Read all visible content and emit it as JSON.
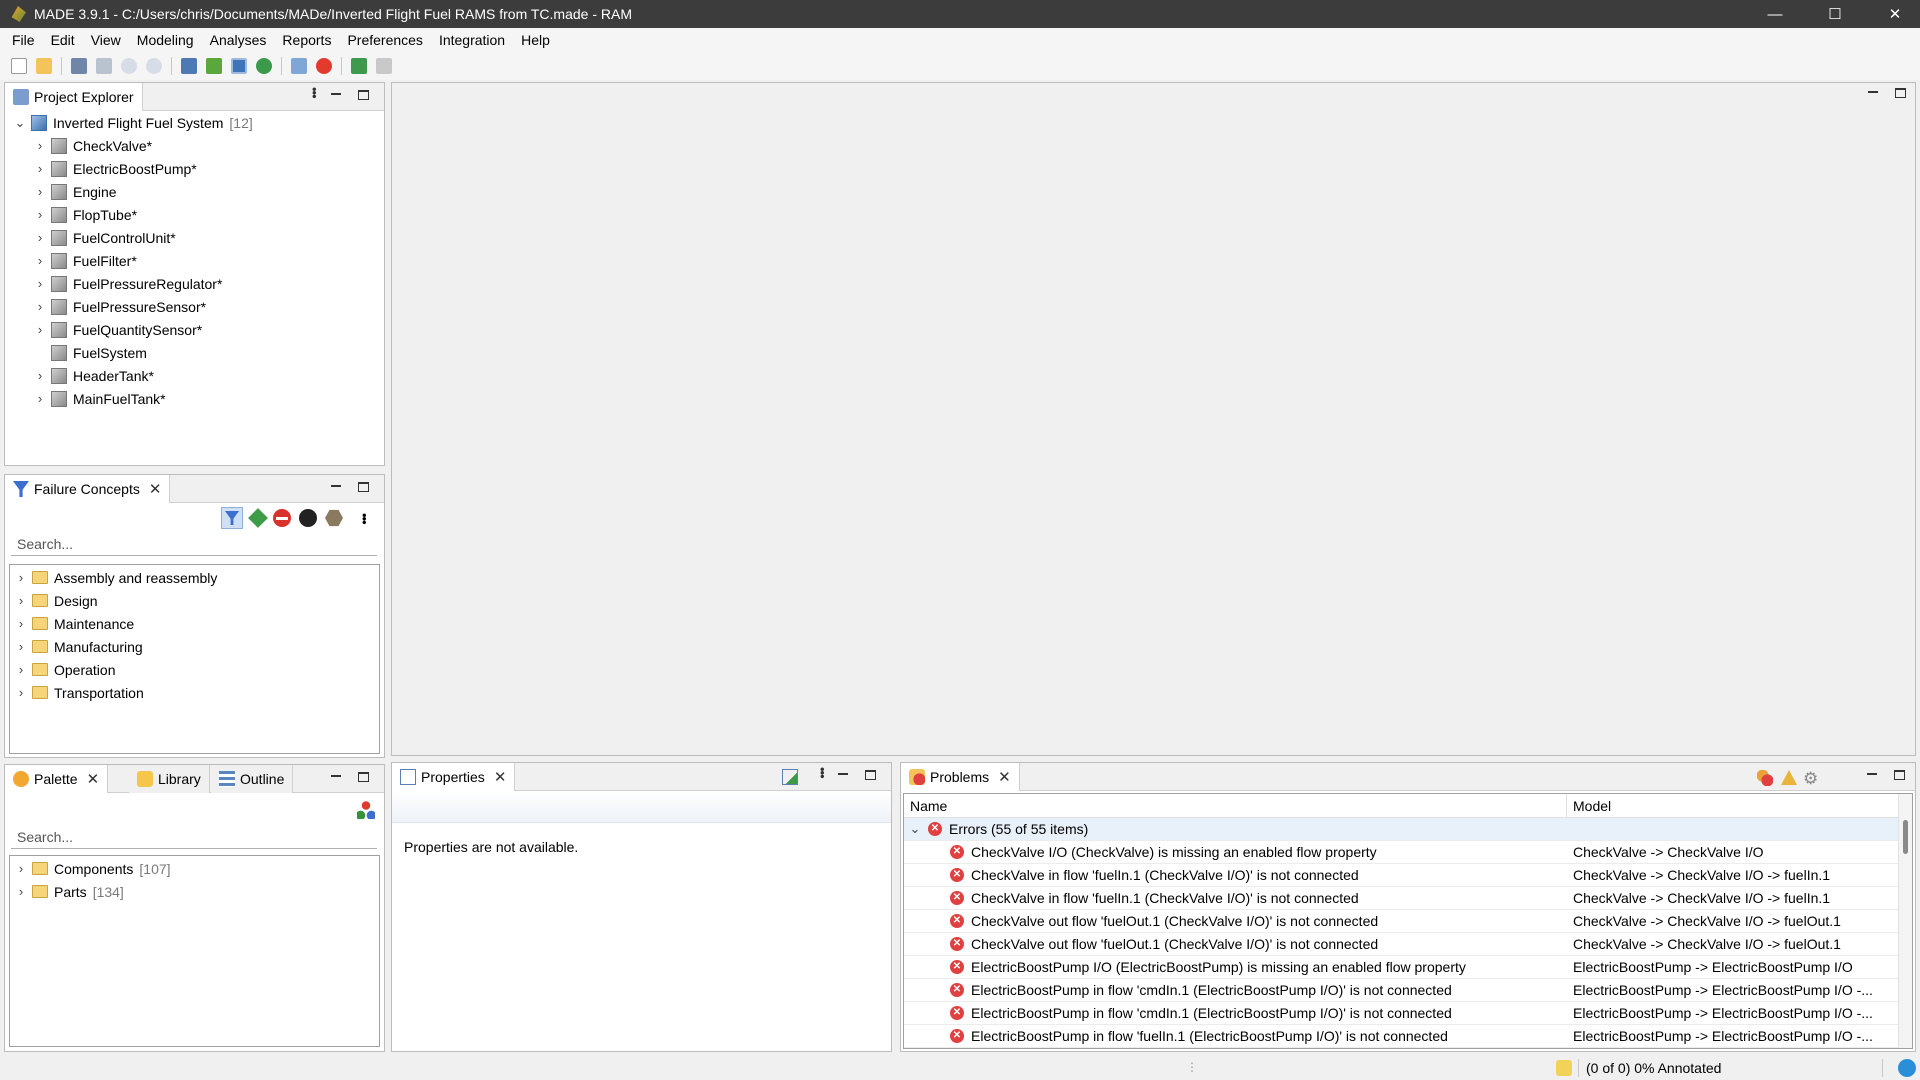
{
  "window": {
    "title": "MADE 3.9.1 - C:/Users/chris/Documents/MADe/Inverted Flight Fuel RAMS from TC.made - RAM",
    "min": "—",
    "max": "☐",
    "close": "✕"
  },
  "menu": [
    "File",
    "Edit",
    "View",
    "Modeling",
    "Analyses",
    "Reports",
    "Preferences",
    "Integration",
    "Help"
  ],
  "toolbar_icons": [
    "new-file-icon",
    "open-folder-icon",
    "save-icon",
    "save-all-icon",
    "undo-icon",
    "redo-icon",
    "hierarchy-icon",
    "chart-icon",
    "diagram-icon",
    "refresh-icon",
    "document-icon",
    "pie-icon",
    "plugin-icon",
    "pilcrow-icon"
  ],
  "project_explorer": {
    "tab": "Project Explorer",
    "root": {
      "label": "Inverted Flight Fuel System",
      "count": "[12]"
    },
    "items": [
      {
        "label": "CheckValve*",
        "expandable": true
      },
      {
        "label": "ElectricBoostPump*",
        "expandable": true
      },
      {
        "label": "Engine",
        "expandable": true
      },
      {
        "label": "FlopTube*",
        "expandable": true
      },
      {
        "label": "FuelControlUnit*",
        "expandable": true
      },
      {
        "label": "FuelFilter*",
        "expandable": true
      },
      {
        "label": "FuelPressureRegulator*",
        "expandable": true
      },
      {
        "label": "FuelPressureSensor*",
        "expandable": true
      },
      {
        "label": "FuelQuantitySensor*",
        "expandable": true
      },
      {
        "label": "FuelSystem",
        "expandable": false
      },
      {
        "label": "HeaderTank*",
        "expandable": true
      },
      {
        "label": "MainFuelTank*",
        "expandable": true
      }
    ]
  },
  "failure_concepts": {
    "tab": "Failure Concepts",
    "search_placeholder": "Search...",
    "filter_icons": [
      "funnel-icon",
      "diamond-icon",
      "no-entry-icon",
      "circle-icon",
      "hexagon-icon"
    ],
    "folders": [
      "Assembly and reassembly",
      "Design",
      "Maintenance",
      "Manufacturing",
      "Operation",
      "Transportation"
    ]
  },
  "palette": {
    "tabs": [
      "Palette",
      "Library",
      "Outline"
    ],
    "search_placeholder": "Search...",
    "folders": [
      {
        "label": "Components",
        "count": "[107]"
      },
      {
        "label": "Parts",
        "count": "[134]"
      }
    ]
  },
  "properties": {
    "tab": "Properties",
    "message": "Properties are not available."
  },
  "problems": {
    "tab": "Problems",
    "columns": [
      "Name",
      "Model"
    ],
    "group": "Errors (55 of 55 items)",
    "rows": [
      {
        "name": "CheckValve I/O (CheckValve) is missing an enabled flow property",
        "model": "CheckValve -> CheckValve I/O"
      },
      {
        "name": "CheckValve in flow 'fuelIn.1 (CheckValve I/O)' is not connected",
        "model": "CheckValve -> CheckValve I/O -> fuelIn.1"
      },
      {
        "name": "CheckValve in flow 'fuelIn.1 (CheckValve I/O)' is not connected",
        "model": "CheckValve -> CheckValve I/O -> fuelIn.1"
      },
      {
        "name": "CheckValve out flow 'fuelOut.1 (CheckValve I/O)' is not connected",
        "model": "CheckValve -> CheckValve I/O -> fuelOut.1"
      },
      {
        "name": "CheckValve out flow 'fuelOut.1 (CheckValve I/O)' is not connected",
        "model": "CheckValve -> CheckValve I/O -> fuelOut.1"
      },
      {
        "name": "ElectricBoostPump I/O (ElectricBoostPump) is missing an enabled flow property",
        "model": "ElectricBoostPump -> ElectricBoostPump I/O"
      },
      {
        "name": "ElectricBoostPump in flow 'cmdIn.1 (ElectricBoostPump I/O)' is not connected",
        "model": "ElectricBoostPump -> ElectricBoostPump I/O -..."
      },
      {
        "name": "ElectricBoostPump in flow 'cmdIn.1 (ElectricBoostPump I/O)' is not connected",
        "model": "ElectricBoostPump -> ElectricBoostPump I/O -..."
      },
      {
        "name": "ElectricBoostPump in flow 'fuelIn.1 (ElectricBoostPump I/O)' is not connected",
        "model": "ElectricBoostPump -> ElectricBoostPump I/O -..."
      }
    ]
  },
  "status": {
    "annotated": "(0 of 0) 0% Annotated"
  }
}
